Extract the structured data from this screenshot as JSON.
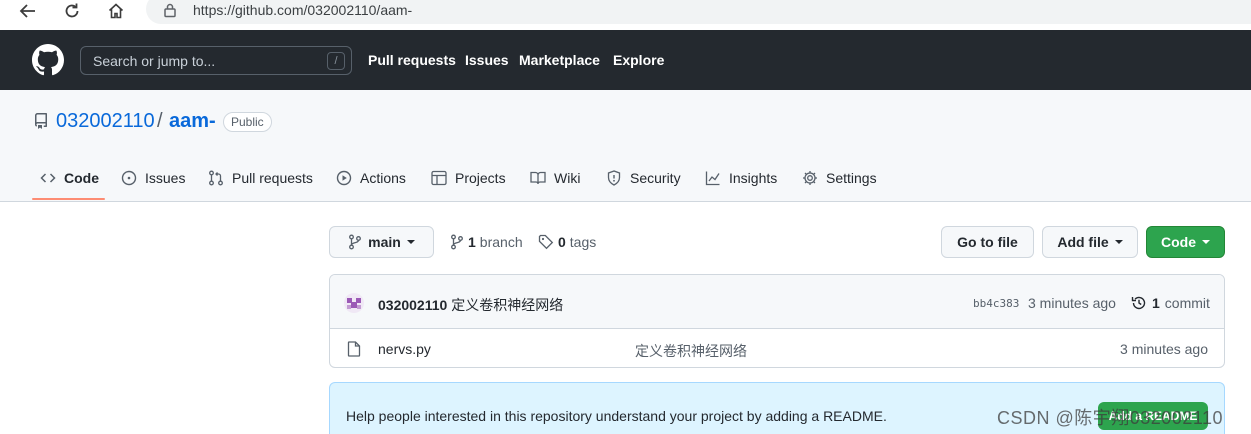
{
  "browser": {
    "url": "https://github.com/032002110/aam-"
  },
  "header": {
    "search_placeholder": "Search or jump to...",
    "search_shortcut": "/",
    "nav": [
      "Pull requests",
      "Issues",
      "Marketplace",
      "Explore"
    ]
  },
  "repo": {
    "owner": "032002110",
    "separator": "/",
    "name": "aam-",
    "visibility": "Public"
  },
  "tabs": [
    {
      "label": "Code",
      "icon": "code-icon",
      "selected": true
    },
    {
      "label": "Issues",
      "icon": "issue-icon"
    },
    {
      "label": "Pull requests",
      "icon": "pull-request-icon"
    },
    {
      "label": "Actions",
      "icon": "play-icon"
    },
    {
      "label": "Projects",
      "icon": "table-icon"
    },
    {
      "label": "Wiki",
      "icon": "book-icon"
    },
    {
      "label": "Security",
      "icon": "shield-icon"
    },
    {
      "label": "Insights",
      "icon": "graph-icon"
    },
    {
      "label": "Settings",
      "icon": "gear-icon"
    }
  ],
  "controls": {
    "branch_label": "main",
    "branch_count": "1",
    "branch_word": "branch",
    "tag_count": "0",
    "tag_word": "tags",
    "go_to_file": "Go to file",
    "add_file": "Add file",
    "code": "Code"
  },
  "latest_commit": {
    "author": "032002110",
    "message": "定义卷积神经网络",
    "sha": "bb4c383",
    "time": "3 minutes ago",
    "commit_count": "1",
    "commit_word": "commit"
  },
  "files": [
    {
      "name": "nervs.py",
      "message": "定义卷积神经网络",
      "time": "3 minutes ago"
    }
  ],
  "readme": {
    "text": "Help people interested in this repository understand your project by adding a README.",
    "button": "Add a README"
  },
  "watermark": "CSDN @陈宇翔032002110",
  "colors": {
    "header_bg": "#24292f",
    "link": "#0969da",
    "green": "#2da44e",
    "tab_underline": "#fd8c73",
    "readme_bg": "#ddf4ff"
  }
}
